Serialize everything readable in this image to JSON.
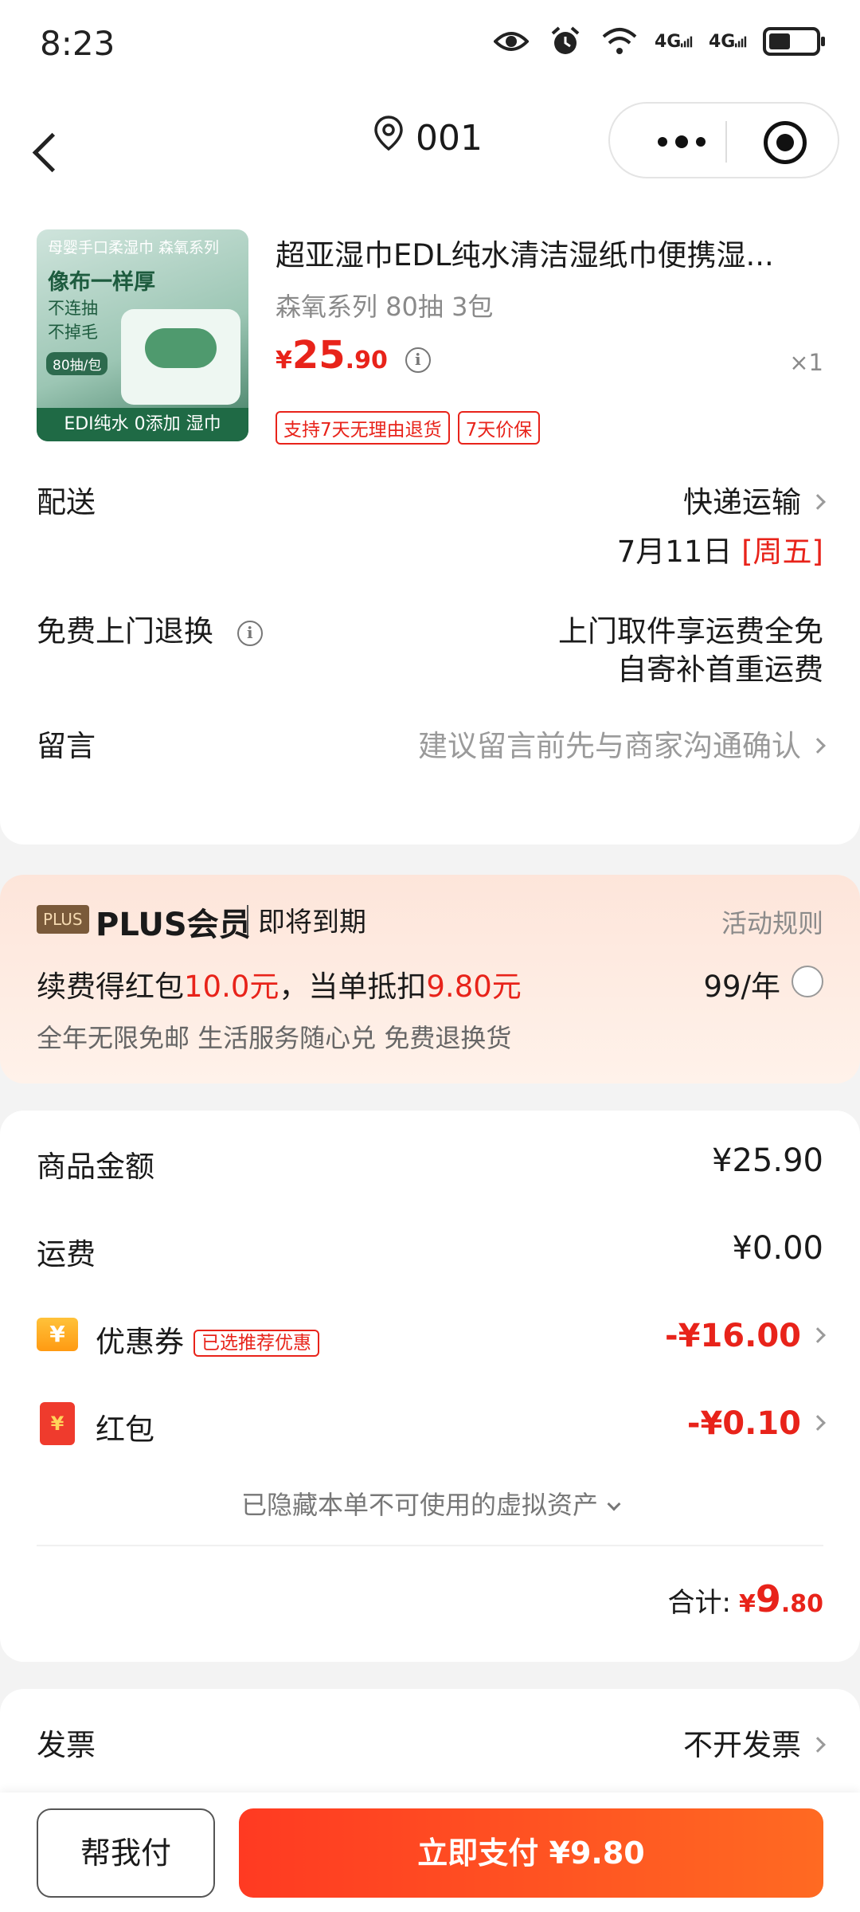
{
  "status_bar": {
    "time": "8:23",
    "net1": "4G",
    "net2": "4G"
  },
  "nav": {
    "address": "001"
  },
  "product": {
    "image_text_top": "母婴手口柔湿巾  森氧系列",
    "image_text_big": "像布一样厚",
    "image_text_lines": "不连抽\n不掉毛",
    "image_text_count": "80抽/包",
    "image_text_band": "EDI纯水  0添加  湿巾",
    "title": "超亚湿巾EDL纯水清洁湿纸巾便携湿...",
    "spec": "森氧系列 80抽 3包",
    "price_currency": "¥",
    "price_int": "25",
    "price_dec": ".90",
    "quantity": "×1",
    "tags": [
      "支持7天无理由退货",
      "7天价保"
    ]
  },
  "delivery": {
    "label": "配送",
    "method": "快递运输",
    "date": "7月11日",
    "weekday": "[周五]"
  },
  "return": {
    "label": "免费上门退换",
    "line1": "上门取件享运费全免",
    "line2": "自寄补首重运费"
  },
  "message": {
    "label": "留言",
    "placeholder": "建议留言前先与商家沟通确认"
  },
  "plus": {
    "badge": "PLUS",
    "title": "PLUS会员",
    "expiring": "即将到期",
    "rules": "活动规则",
    "renew_prefix": "续费得红包",
    "renew_amount": "10.0元",
    "renew_mid": "，当单抵扣",
    "renew_deduct": "9.80元",
    "price": "99/年",
    "benefits": "全年无限免邮 生活服务随心兑 免费退换货"
  },
  "amount": {
    "goods_label": "商品金额",
    "goods_value": "¥25.90",
    "shipping_label": "运费",
    "shipping_value": "¥0.00",
    "coupon_icon": "¥",
    "coupon_label": "优惠券",
    "coupon_tag": "已选推荐优惠",
    "coupon_value": "-¥16.00",
    "redpacket_icon": "¥",
    "redpacket_label": "红包",
    "redpacket_value": "-¥0.10",
    "hidden_note": "已隐藏本单不可使用的虚拟资产",
    "total_label": "合计:",
    "total_currency": "¥",
    "total_int": "9",
    "total_dec": ".80"
  },
  "invoice": {
    "label": "发票",
    "value": "不开发票"
  },
  "bottom": {
    "help_pay": "帮我付",
    "pay_now": "立即支付 ¥9.80"
  },
  "colors": {
    "accent_red": "#e8231a",
    "pay_gradient_start": "#ff3a22",
    "pay_gradient_end": "#ff6a22"
  }
}
